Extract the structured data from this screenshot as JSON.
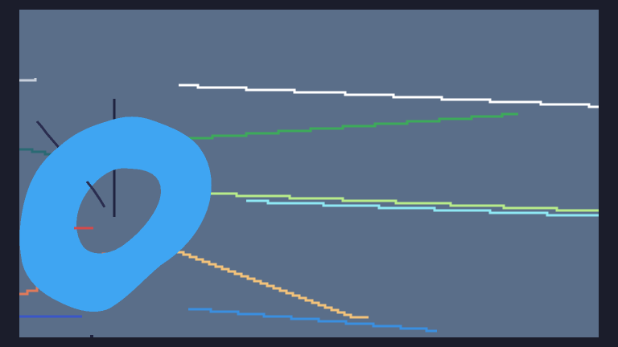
{
  "scene": {
    "background": "#5a6e89",
    "frame_color": "#1b1d2b",
    "ring_color": "#3fa5f2",
    "stroke_colors": {
      "white": "#ffffff",
      "green": "#3daa5a",
      "lime": "#b8ec8a",
      "cyan": "#8fe8f4",
      "orange": "#f2c27a",
      "blue": "#3a8fe0",
      "dark": "#1f2340",
      "navy": "#2a2d4f",
      "teal": "#2a6a74",
      "red": "#d44a4a",
      "salmon": "#e07a5a",
      "indigo": "#3a56c8",
      "gray": "#c8d0dc"
    }
  }
}
